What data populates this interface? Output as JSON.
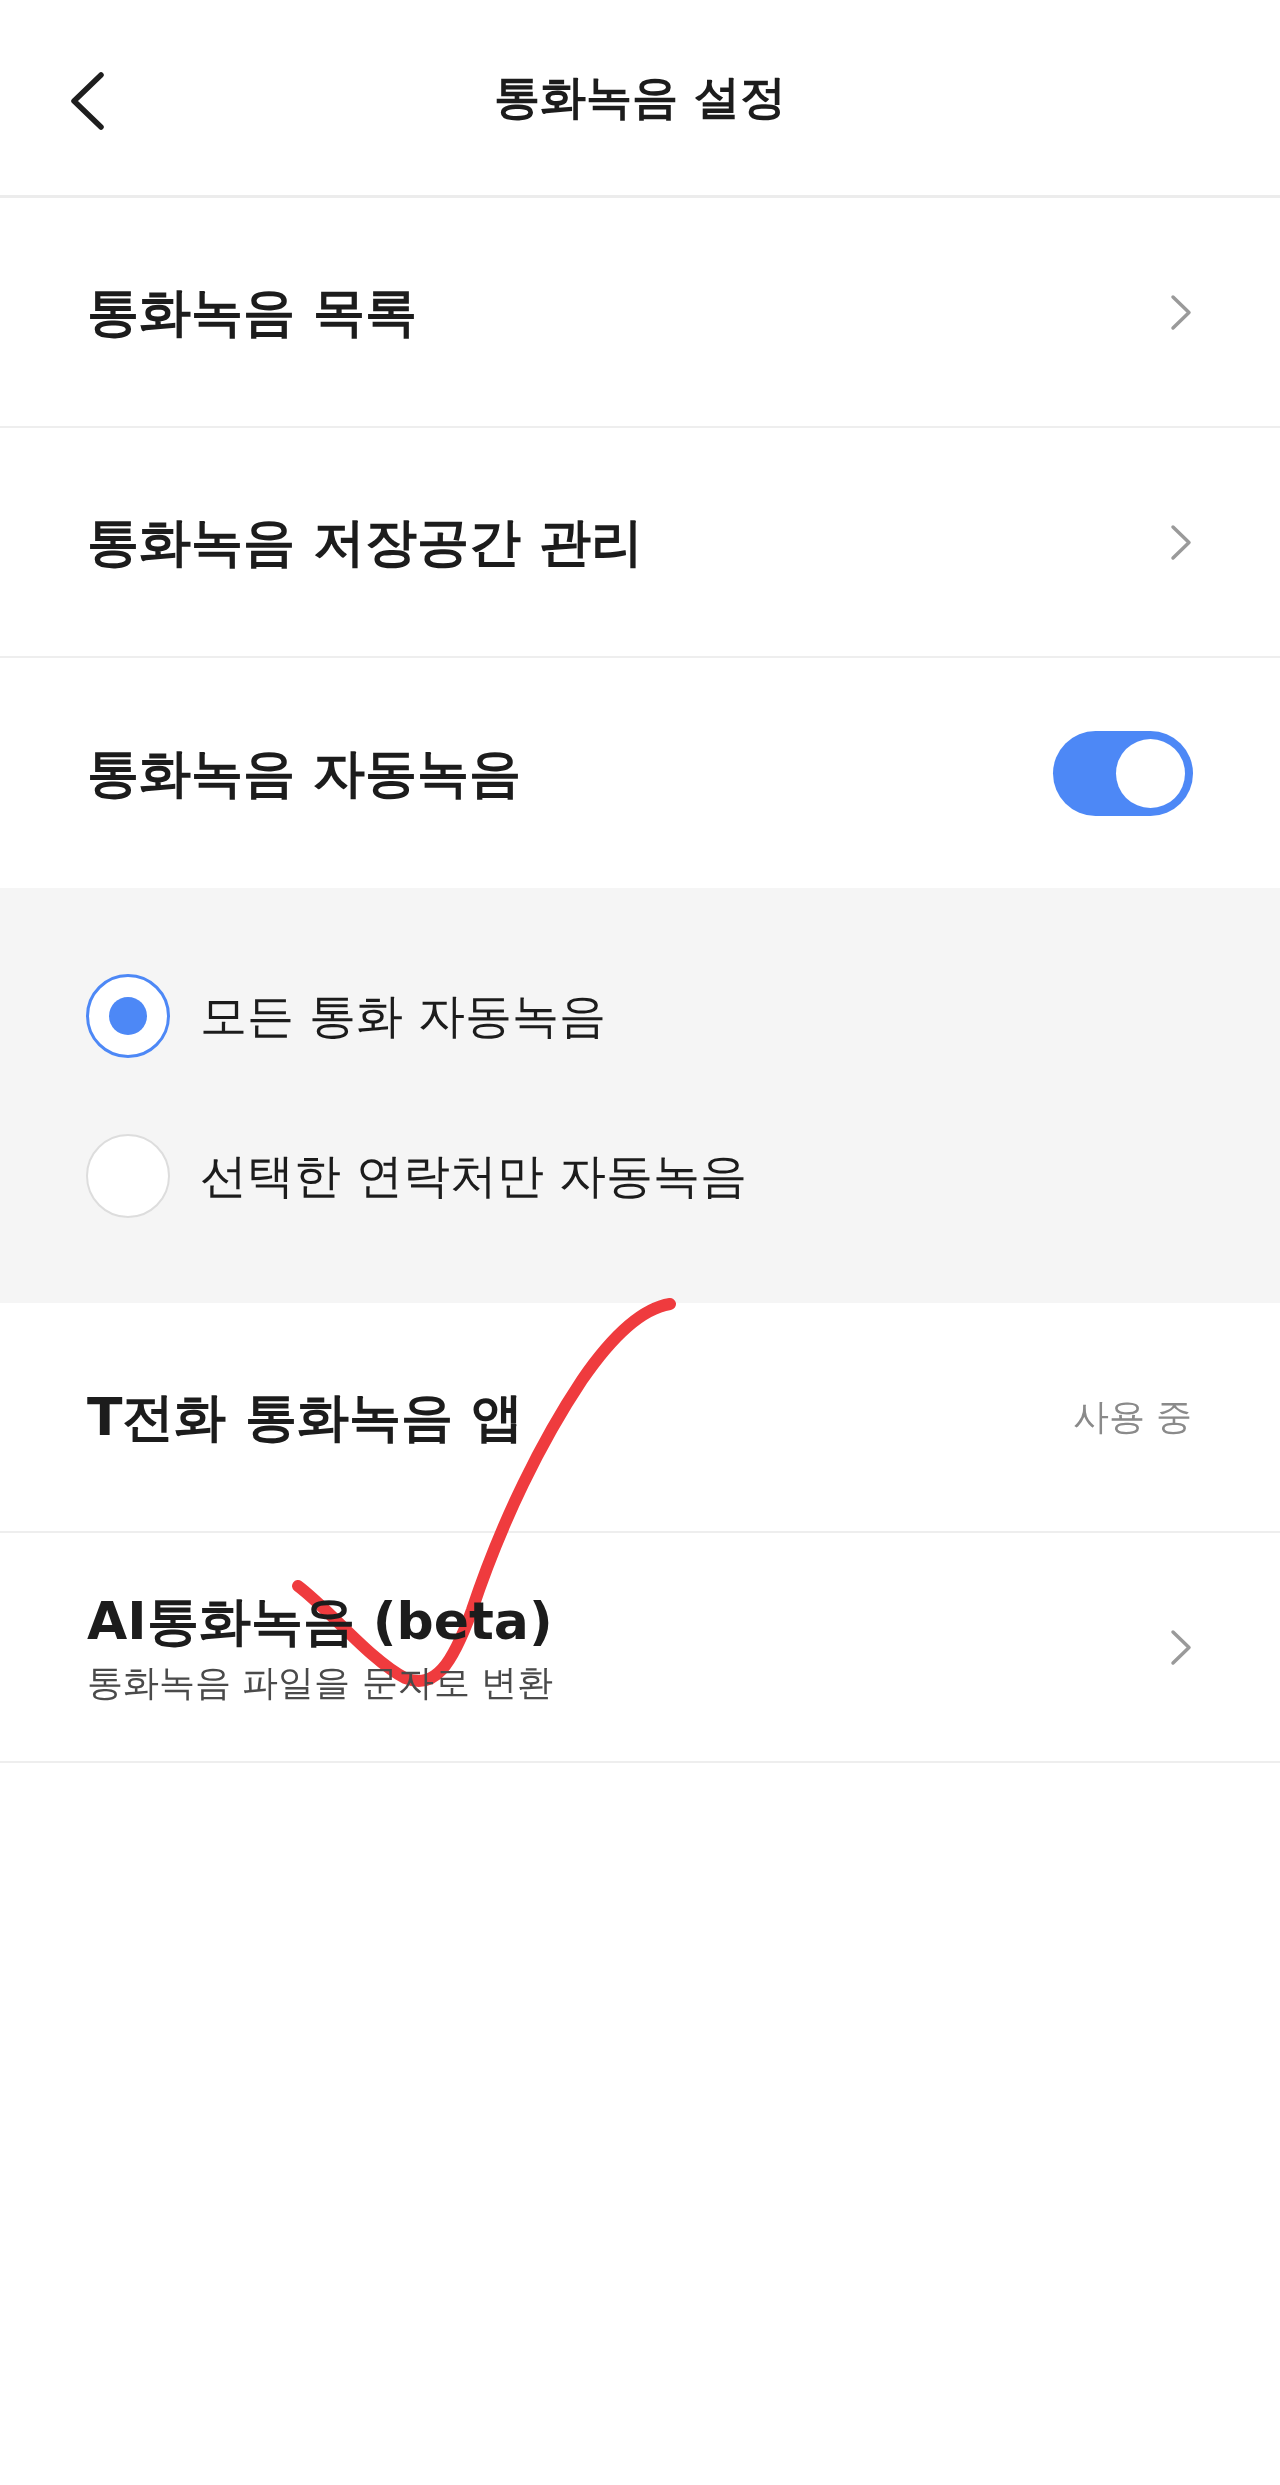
{
  "header": {
    "title": "통화녹음 설정"
  },
  "rows": [
    {
      "kind": "link",
      "label": "통화녹음 목록"
    },
    {
      "kind": "link",
      "label": "통화녹음 저장공간 관리"
    }
  ],
  "auto_record": {
    "label": "통화녹음 자동녹음",
    "on": true,
    "options": [
      {
        "label": "모든 통화 자동녹음",
        "selected": true
      },
      {
        "label": "선택한 연락처만 자동녹음",
        "selected": false
      }
    ]
  },
  "more_rows": [
    {
      "kind": "status",
      "label": "T전화 통화녹음 앱",
      "status": "사용 중"
    },
    {
      "kind": "link",
      "label": "AI통화녹음 (beta)",
      "subtitle": "통화녹음 파일을 문자로 변환"
    }
  ]
}
